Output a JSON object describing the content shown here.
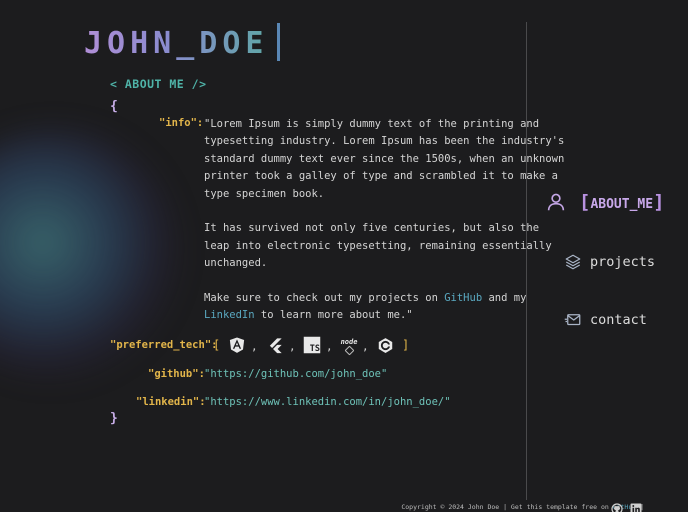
{
  "header": {
    "title": "JOHN_DOE",
    "section": "< ABOUT ME />"
  },
  "code": {
    "open_brace": "{",
    "close_brace": "}",
    "info_key": "\"info\":",
    "info_lines_p1": [
      "\"Lorem Ipsum is simply dummy text of the printing and",
      "typesetting industry. Lorem Ipsum has been the industry's",
      "standard dummy text ever since the 1500s, when an unknown",
      "printer took a galley of type and scrambled it to make a",
      "type specimen book."
    ],
    "info_lines_p2": [
      "It has survived not only five centuries, but also the",
      "leap into electronic typesetting, remaining essentially",
      "unchanged."
    ],
    "info_p3_before": "Make sure to check out my projects on ",
    "info_p3_link1": "GitHub",
    "info_p3_mid": " and my",
    "info_p3_link2": "LinkedIn",
    "info_p3_after": " to learn more about me.\"",
    "preferred_tech_key": "\"preferred_tech\":",
    "open_bracket": "[",
    "close_bracket": "]",
    "tech_ts_label": "TS",
    "tech_node_label": "node",
    "github_key": "\"github\":",
    "github_value": "\"https://github.com/john_doe\"",
    "linkedin_key": "\"linkedin\":",
    "linkedin_value": "\"https://www.linkedin.com/in/john_doe/\""
  },
  "tech_icons": [
    "angular-icon",
    "flutter-icon",
    "typescript-icon",
    "nodejs-icon",
    "c-language-icon"
  ],
  "nav": {
    "about_open": "[",
    "about_label": "ABOUT_ME",
    "about_close": "]",
    "projects_label": "projects",
    "contact_label": "contact"
  },
  "footer": {
    "text": "Copyright © 2024 John Doe | Get this template free on ",
    "link": "GitHub",
    "sep": " |"
  },
  "colors": {
    "background": "#1c1c1e",
    "accent_purple": "#c8a8ea",
    "key_gold": "#e2b54a",
    "string_teal": "#6ec2b8"
  }
}
